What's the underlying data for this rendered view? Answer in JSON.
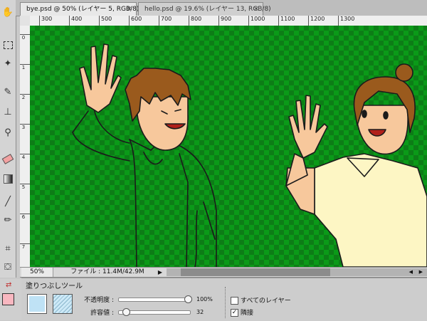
{
  "tabs": [
    {
      "label": "bye.psd @ 50% (レイヤー 5, RGB/8) *",
      "close": "×"
    },
    {
      "label": "hello.psd @ 19.6% (レイヤー 13, RGB/8)",
      "close": "×"
    }
  ],
  "ruler": {
    "horizontal": [
      "300",
      "400",
      "500",
      "600",
      "700",
      "800",
      "900",
      "1000",
      "1100",
      "1200",
      "1300"
    ],
    "vertical": [
      "0",
      "1",
      "2",
      "3",
      "4",
      "5",
      "6",
      "7"
    ]
  },
  "status": {
    "zoom": "50%",
    "file_info": "ファイル : 11.4M/42.9M",
    "arrow": "▶"
  },
  "tool_options": {
    "tool_name": "塗りつぶしツール",
    "opacity_label": "不透明度 :",
    "opacity_value": "100%",
    "tolerance_label": "許容値 :",
    "tolerance_value": "32",
    "all_layers_label": "すべてのレイヤー",
    "all_layers_checked": false,
    "contiguous_label": "隣接",
    "contiguous_checked": true
  },
  "tools": [
    "hand-icon",
    "marquee-icon",
    "magic-wand-icon",
    "brush-icon",
    "stamp-icon",
    "zoom-icon",
    "eraser-icon",
    "gradient-icon",
    "line-icon",
    "pencil-icon",
    "transform-icon",
    "bucket-icon"
  ],
  "colors": {
    "foreground": "#f8b7c0",
    "background": "#ffffff",
    "canvas_green": "#0a9a18",
    "canvas_dark_green": "#0d7d17"
  }
}
